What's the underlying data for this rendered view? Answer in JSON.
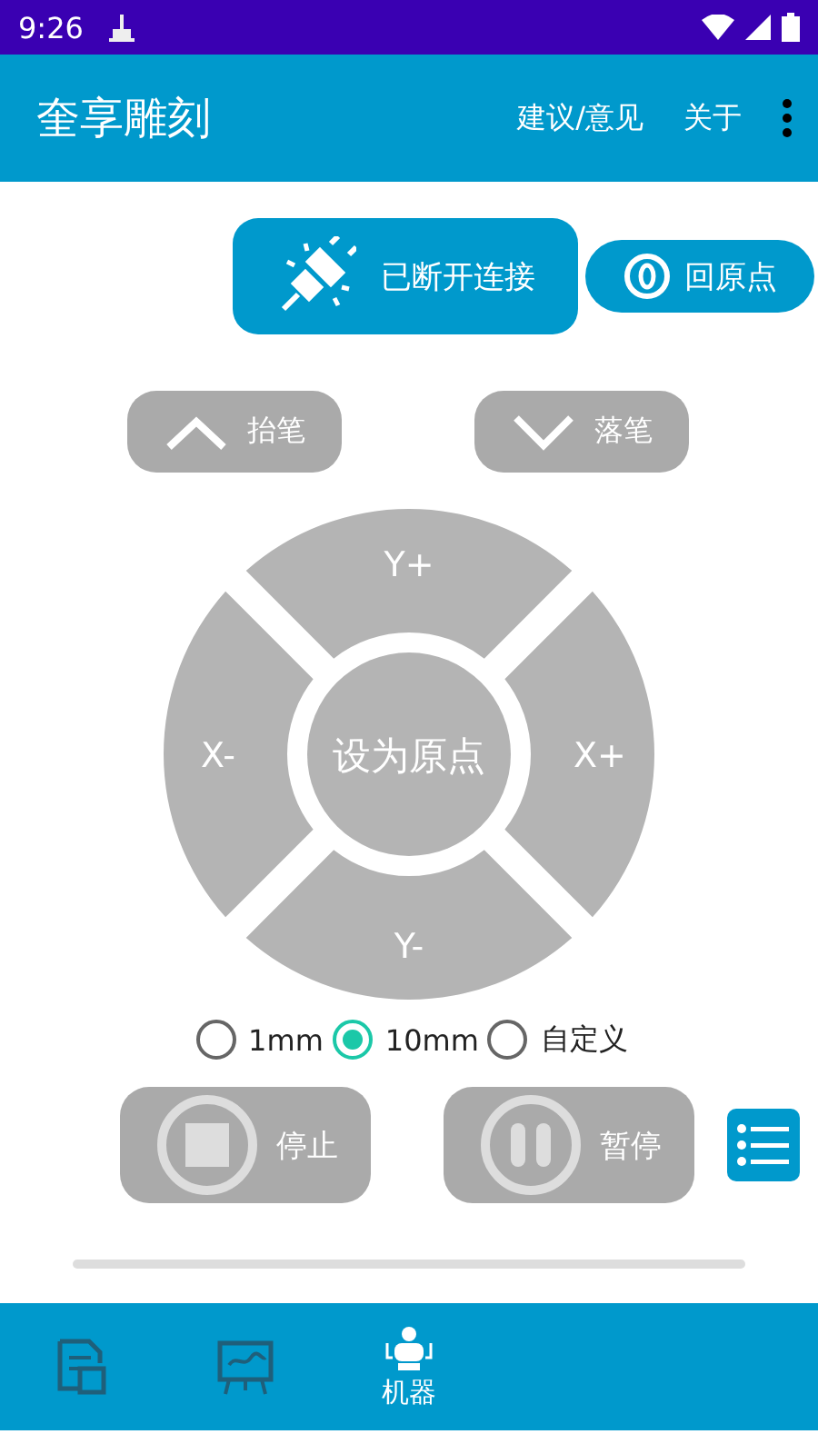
{
  "status_bar": {
    "time": "9:26"
  },
  "app_bar": {
    "title": "奎享雕刻",
    "actions": [
      "建议/意见",
      "关于"
    ]
  },
  "connection": {
    "label": "已断开连接",
    "connected": false
  },
  "home_button": {
    "label": "回原点"
  },
  "pen": [
    {
      "kind": "up",
      "label": "抬笔"
    },
    {
      "kind": "down",
      "label": "落笔"
    }
  ],
  "pad": {
    "up": "Y+",
    "down": "Y-",
    "left": "X-",
    "right": "X+",
    "center": "设为原点"
  },
  "steps": [
    {
      "label": "1mm",
      "selected": false
    },
    {
      "label": "10mm",
      "selected": true
    },
    {
      "label": "自定义",
      "selected": false
    }
  ],
  "controls": [
    {
      "kind": "stop",
      "label": "停止"
    },
    {
      "kind": "pause",
      "label": "暂停"
    }
  ],
  "progress": {
    "level": 0
  },
  "nav": [
    {
      "kind": "document",
      "selected": false
    },
    {
      "kind": "canvas",
      "selected": false
    },
    {
      "kind": "robot",
      "label": "机器",
      "selected": true
    }
  ]
}
